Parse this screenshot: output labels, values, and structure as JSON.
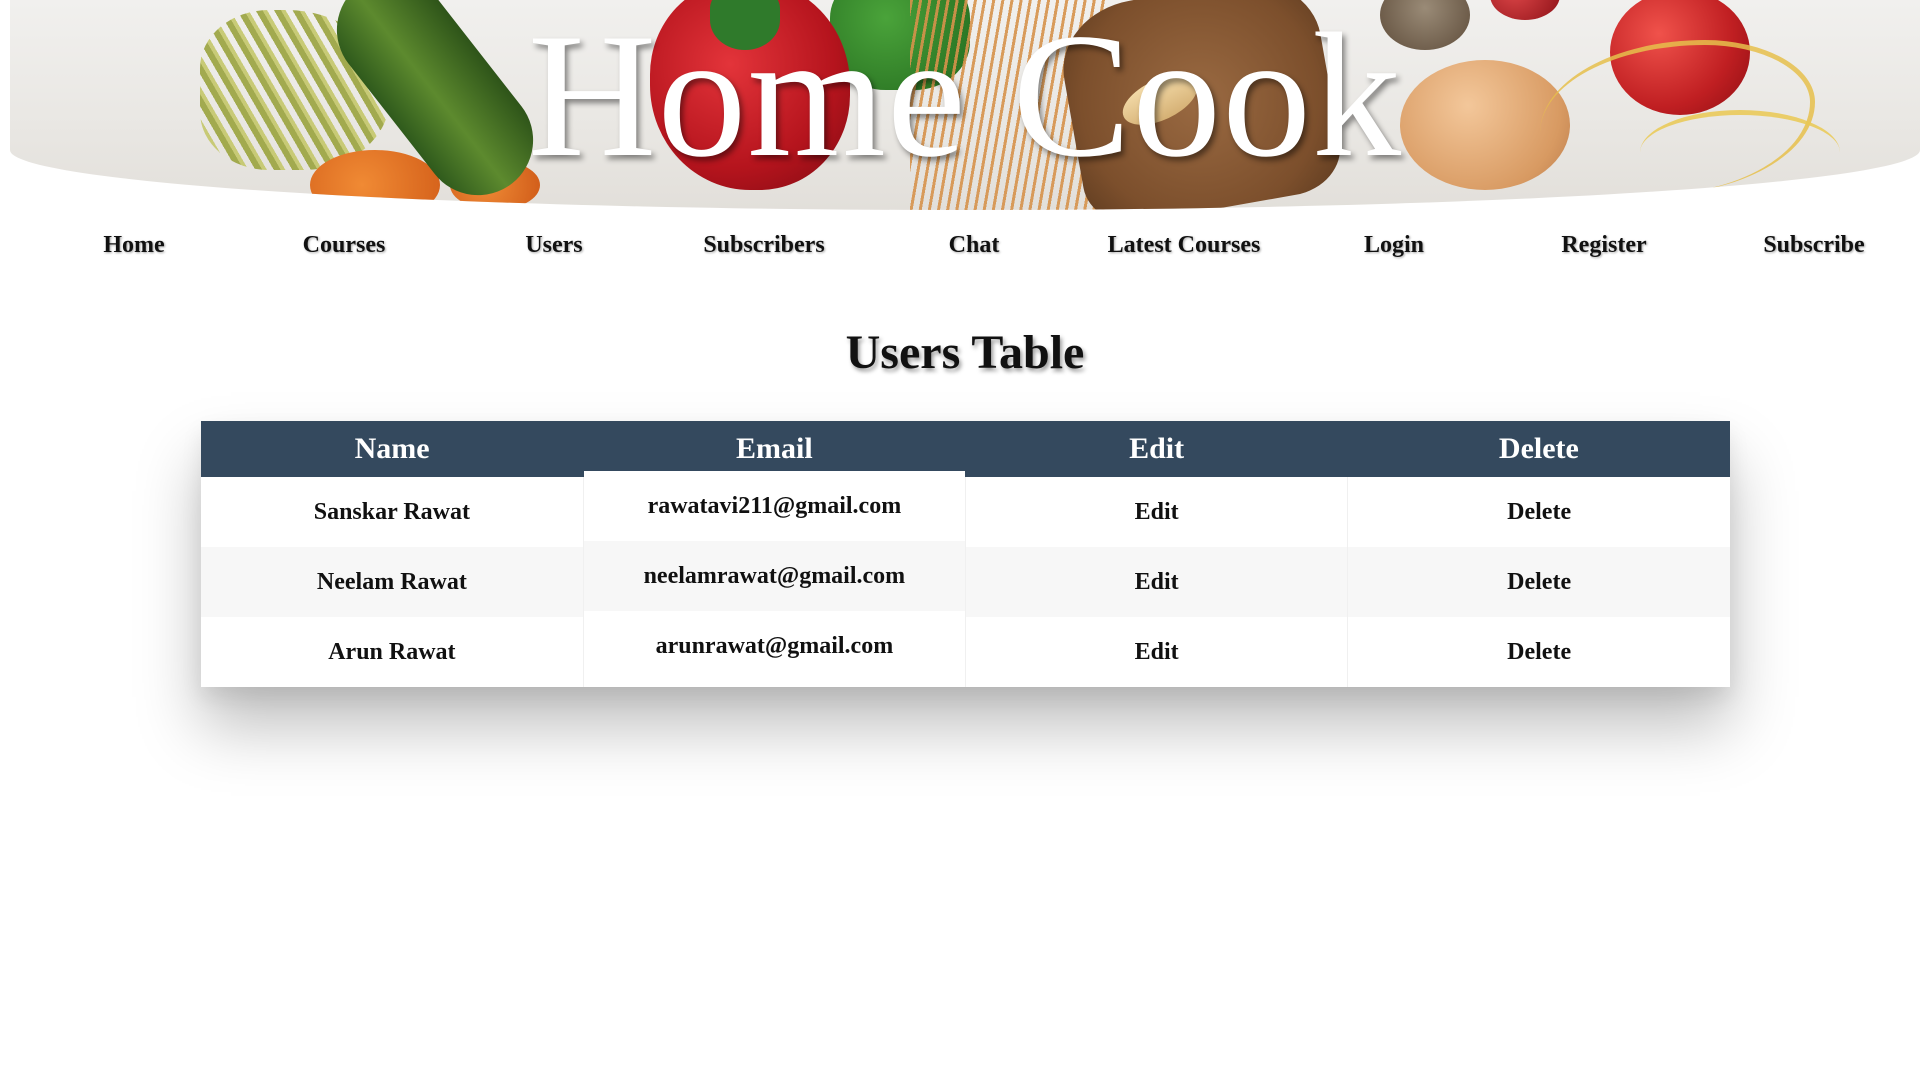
{
  "header": {
    "site_title": "Home Cook"
  },
  "nav": {
    "items": [
      "Home",
      "Courses",
      "Users",
      "Subscribers",
      "Chat",
      "Latest Courses",
      "Login",
      "Register",
      "Subscribe"
    ]
  },
  "main": {
    "title": "Users Table",
    "table": {
      "columns": [
        "Name",
        "Email",
        "Edit",
        "Delete"
      ],
      "rows": [
        {
          "name": "Sanskar Rawat",
          "email": "rawatavi211@gmail.com",
          "edit": "Edit",
          "delete": "Delete"
        },
        {
          "name": "Neelam Rawat",
          "email": "neelamrawat@gmail.com",
          "edit": "Edit",
          "delete": "Delete"
        },
        {
          "name": "Arun Rawat",
          "email": "arunrawat@gmail.com",
          "edit": "Edit",
          "delete": "Delete"
        }
      ]
    }
  },
  "colors": {
    "table_header_bg": "#34495e",
    "table_header_text": "#ffffff"
  }
}
